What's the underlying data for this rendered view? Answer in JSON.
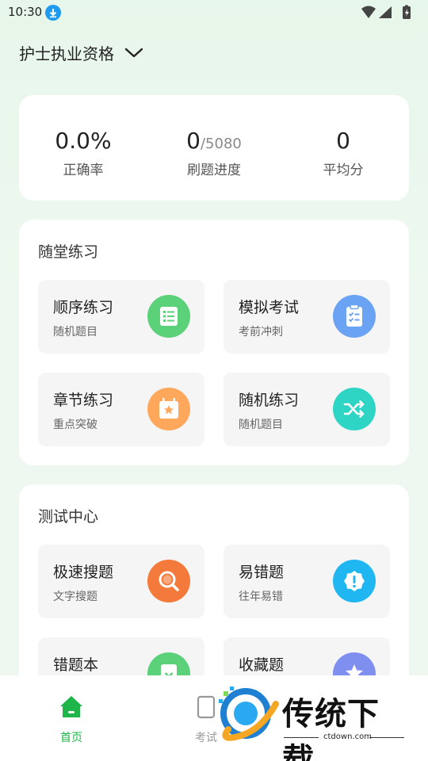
{
  "status_bar": {
    "time": "10:30"
  },
  "header": {
    "title": "护士执业资格"
  },
  "stats": [
    {
      "value": "0.0%",
      "total": "",
      "label": "正确率"
    },
    {
      "value": "0",
      "total": "/5080",
      "label": "刷题进度"
    },
    {
      "value": "0",
      "total": "",
      "label": "平均分"
    }
  ],
  "practice": {
    "title": "随堂练习",
    "tiles": [
      {
        "title": "顺序练习",
        "sub": "随机题目",
        "icon": "list-icon",
        "color": "#5bd17a"
      },
      {
        "title": "模拟考试",
        "sub": "考前冲刺",
        "icon": "clipboard-check-icon",
        "color": "#6aa2f4"
      },
      {
        "title": "章节练习",
        "sub": "重点突破",
        "icon": "calendar-star-icon",
        "color": "#ffa75a"
      },
      {
        "title": "随机练习",
        "sub": "随机题目",
        "icon": "shuffle-icon",
        "color": "#2ed4c4"
      }
    ]
  },
  "test_center": {
    "title": "测试中心",
    "tiles": [
      {
        "title": "极速搜题",
        "sub": "文字搜题",
        "icon": "search-icon",
        "color": "#f47a3b"
      },
      {
        "title": "易错题",
        "sub": "往年易错",
        "icon": "alert-badge-icon",
        "color": "#1fb6f2"
      },
      {
        "title": "错题本",
        "sub": "",
        "icon": "error-book-icon",
        "color": "#5bd17a"
      },
      {
        "title": "收藏题",
        "sub": "",
        "icon": "star-icon",
        "color": "#7f8ff0"
      }
    ]
  },
  "nav": {
    "items": [
      {
        "label": "首页",
        "active": true
      },
      {
        "label": "考试",
        "active": false
      }
    ]
  },
  "watermark": {
    "text": "传统下载",
    "url": "ctdown.com"
  },
  "colors": {
    "accent": "#1fb54a"
  }
}
